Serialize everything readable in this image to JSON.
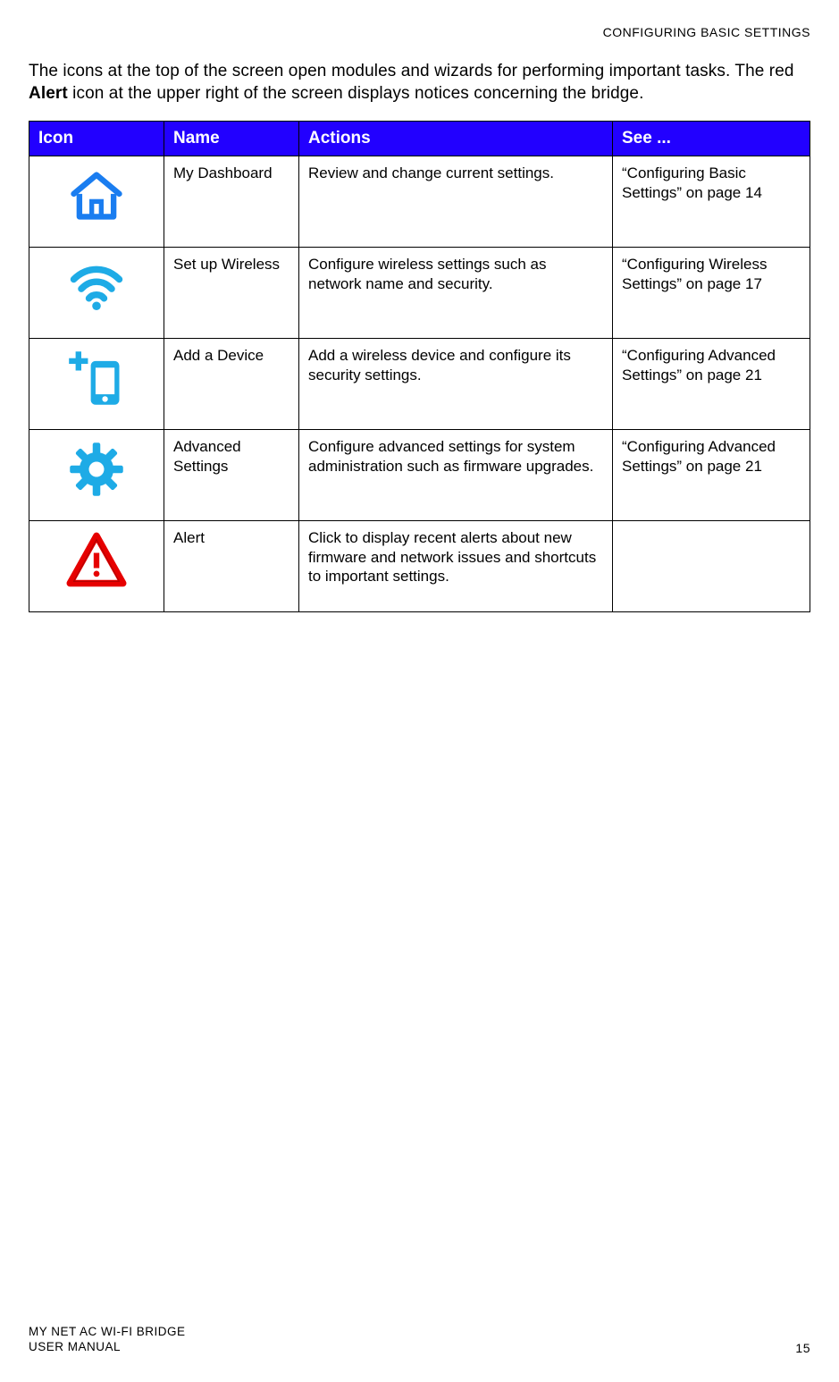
{
  "header": {
    "section": "CONFIGURING BASIC SETTINGS"
  },
  "intro": {
    "part1": "The icons at the top of the screen open modules and wizards for performing important tasks. The red ",
    "bold": "Alert",
    "part2": " icon at the upper right of the screen displays notices concerning the bridge."
  },
  "table": {
    "headers": {
      "icon": "Icon",
      "name": "Name",
      "actions": "Actions",
      "see": "See ..."
    },
    "rows": [
      {
        "icon": "home-icon",
        "name": "My Dashboard",
        "actions": "Review and change current settings.",
        "see": "“Configuring Basic Settings” on page 14"
      },
      {
        "icon": "wifi-icon",
        "name": "Set up Wireless",
        "actions": "Configure wireless settings such as network name and security.",
        "see": "“Configuring Wireless Settings” on page 17"
      },
      {
        "icon": "add-device-icon",
        "name": "Add a Device",
        "actions": "Add a wireless device and configure its security settings.",
        "see": "“Configuring Advanced Settings” on page 21"
      },
      {
        "icon": "gear-icon",
        "name": "Advanced Settings",
        "actions": "Configure advanced settings for system administration such as firmware upgrades.",
        "see": "“Configuring Advanced Settings” on page 21"
      },
      {
        "icon": "alert-icon",
        "name": "Alert",
        "actions": "Click to display recent alerts about new firmware and network issues and shortcuts to important settings.",
        "see": ""
      }
    ]
  },
  "footer": {
    "product": "MY NET AC WI-FI BRIDGE",
    "doc": "USER MANUAL",
    "page": "15"
  },
  "colors": {
    "accent_blue": "#2200ff",
    "icon_blue": "#1eabe6",
    "icon_blue_dark": "#1a7df0",
    "alert_red": "#e60000",
    "alert_red_dark": "#b00000"
  }
}
